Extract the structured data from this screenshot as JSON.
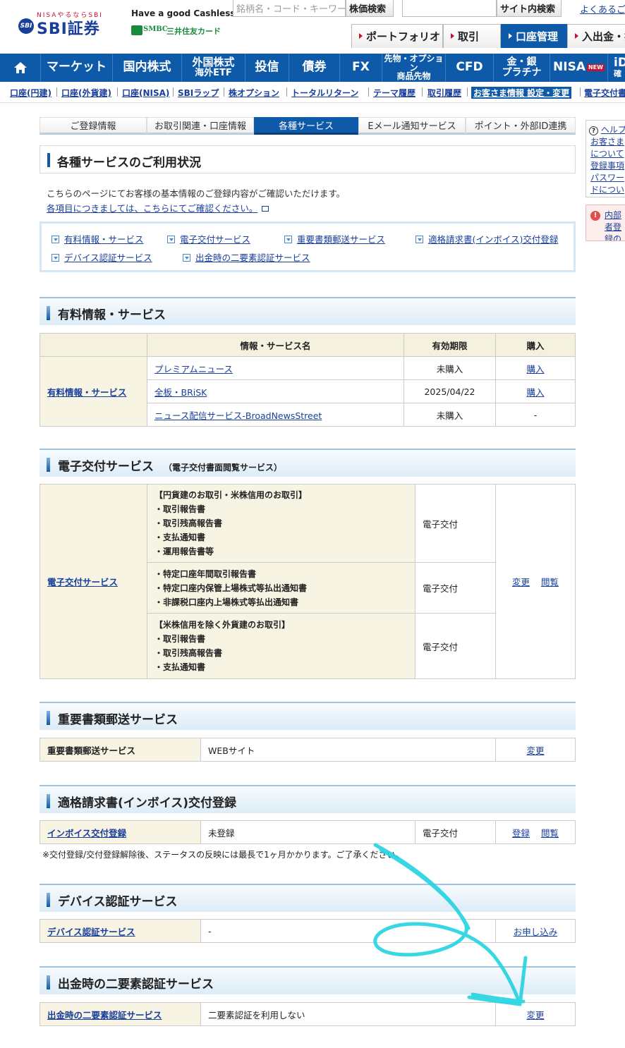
{
  "header": {
    "brand_tagline": "NISAやるならSBI",
    "brand_mark": "SBI",
    "brand_name": "SBI証券",
    "cashless": "Have a good Cashless.",
    "smbc": "SMBC",
    "smbc_card": "三井住友カード",
    "stock_search_placeholder": "銘柄名・コード・キーワード",
    "stock_search_button": "株価検索",
    "site_search_button": "サイト内検索",
    "faq_link": "よくあるご質問",
    "primary_tabs": [
      "ポートフォリオ",
      "取引",
      "口座管理",
      "入出金・振替"
    ]
  },
  "global_nav": {
    "items": [
      {
        "label": "マーケット"
      },
      {
        "label": "国内株式"
      },
      {
        "label": "外国株式",
        "sub": "海外ETF"
      },
      {
        "label": "投信"
      },
      {
        "label": "債券"
      },
      {
        "label": "FX"
      },
      {
        "label": "先物・オプション",
        "sub": "商品先物"
      },
      {
        "label": "CFD"
      },
      {
        "label": "金・銀",
        "sub": "プラチナ"
      },
      {
        "label": "NISA",
        "badge": "NEW"
      },
      {
        "label": "iD",
        "sub": "確"
      }
    ]
  },
  "sub_nav": [
    "口座(円建)",
    "口座(外貨建)",
    "口座(NISA)",
    "SBIラップ",
    "株オプション",
    "トータルリターン",
    "テーマ履歴",
    "取引履歴",
    "お客さま情報 設定・変更",
    "電子交付書面"
  ],
  "page_tabs": [
    "ご登録情報",
    "お取引関連・口座情報",
    "各種サービス",
    "Eメール通知サービス",
    "ポイント・外部ID連携"
  ],
  "main": {
    "title": "各種サービスのご利用状況",
    "intro": "こちらのページにてお客様の基本情報のご登録内容がご確認いただけます。",
    "intro_link": "各項目につきましては、こちらにてご確認ください。",
    "anchors": [
      "有料情報・サービス",
      "電子交付サービス",
      "重要書類郵送サービス",
      "適格請求書(インボイス)交付登録",
      "デバイス認証サービス",
      "出金時の二要素認証サービス"
    ]
  },
  "paid": {
    "heading": "有料情報・サービス",
    "headers": [
      "情報・サービス名",
      "有効期限",
      "購入"
    ],
    "row_label": "有料情報・サービス",
    "rows": [
      {
        "name": "プレミアムニュース",
        "expiry": "未購入",
        "action": "購入"
      },
      {
        "name": "全板・BRiSK",
        "expiry": "2025/04/22",
        "action": "購入"
      },
      {
        "name": "ニュース配信サービス-BroadNewsStreet",
        "expiry": "未購入",
        "action": "-"
      }
    ]
  },
  "edelivery": {
    "heading": "電子交付サービス",
    "subheading": "（電子交付書面閲覧サービス）",
    "row_label": "電子交付サービス",
    "groups": [
      {
        "lines": [
          "【円貨建のお取引・米株信用のお取引】",
          "・取引報告書",
          "・取引残高報告書",
          "・支払通知書",
          "・運用報告書等"
        ],
        "status": "電子交付"
      },
      {
        "lines": [
          "・特定口座年間取引報告書",
          "・特定口座内保管上場株式等払出通知書",
          "・非課税口座内上場株式等払出通知書"
        ],
        "status": "電子交付"
      },
      {
        "lines": [
          "【米株信用を除く外貨建のお取引】",
          "・取引報告書",
          "・取引残高報告書",
          "・支払通知書"
        ],
        "status": "電子交付"
      }
    ],
    "action_change": "変更",
    "action_view": "閲覧"
  },
  "mail": {
    "heading": "重要書類郵送サービス",
    "label": "重要書類郵送サービス",
    "value": "WEBサイト",
    "action": "変更"
  },
  "invoice": {
    "heading": "適格請求書(インボイス)交付登録",
    "label": "インボイス交付登録",
    "value": "未登録",
    "status": "電子交付",
    "action_register": "登録",
    "action_view": "閲覧",
    "note": "※交付登録/交付登録解除後、ステータスの反映には最長で1ヶ月かかります。ご了承ください。"
  },
  "device": {
    "heading": "デバイス認証サービス",
    "label": "デバイス認証サービス",
    "value": "-",
    "action": "お申し込み"
  },
  "twofactor": {
    "heading": "出金時の二要素認証サービス",
    "label": "出金時の二要素認証サービス",
    "value": "二要素認証を利用しない",
    "action": "変更"
  },
  "side": {
    "help_title": "ヘルプ",
    "help_links": [
      "お客さまについて",
      "登録事項",
      "パスワードについて"
    ],
    "warning": "内部者登録のお願い"
  },
  "colors": {
    "brand_blue": "#0f5aa8",
    "link": "#1a3f9a",
    "annotation": "#22d3e0"
  }
}
